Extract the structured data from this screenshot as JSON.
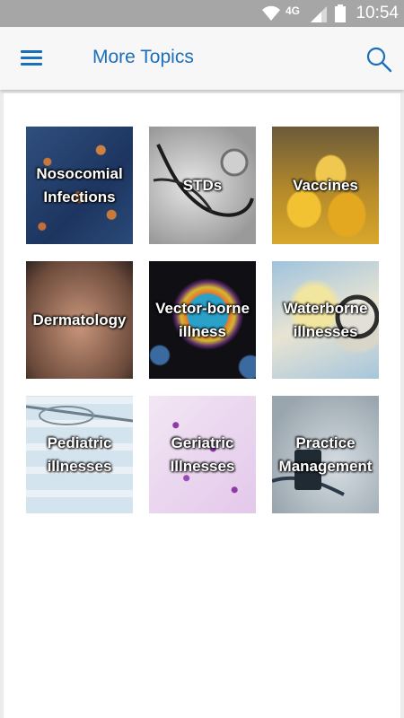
{
  "status_bar": {
    "time": "10:54",
    "network": "4G",
    "icons": [
      "wifi-icon",
      "signal-icon",
      "battery-icon"
    ]
  },
  "app_bar": {
    "title": "More Topics",
    "menu_icon": "menu-icon",
    "search_icon": "search-icon",
    "accent_color": "#1b6fba"
  },
  "topics": [
    {
      "label": "Nosocomial\nInfections"
    },
    {
      "label": "STDs"
    },
    {
      "label": "Vaccines"
    },
    {
      "label": "Dermatology"
    },
    {
      "label": "Vector-borne\nillness"
    },
    {
      "label": "Waterborne\nillnesses"
    },
    {
      "label": "Pediatric\nillnesses"
    },
    {
      "label": "Geriatric\nIllnesses"
    },
    {
      "label": "Practice\nManagement"
    }
  ]
}
